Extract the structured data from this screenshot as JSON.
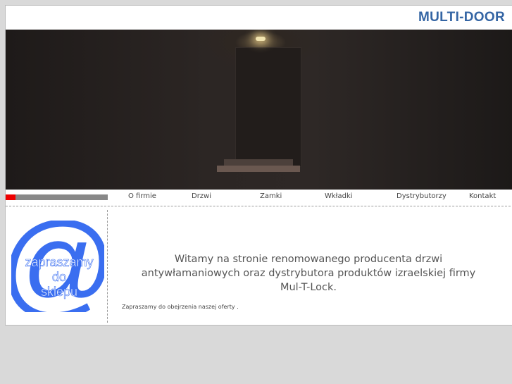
{
  "header": {
    "logo": "MULTI-DOOR"
  },
  "nav": {
    "items": [
      {
        "label": "O firmie"
      },
      {
        "label": "Drzwi"
      },
      {
        "label": "Zamki"
      },
      {
        "label": "Wkładki"
      },
      {
        "label": "Dystrybutorzy"
      },
      {
        "label": "Kontakt"
      }
    ]
  },
  "promo": {
    "line1": "zapraszamy",
    "line2": "do",
    "line3": "sklepu",
    "color": "#3a6ef0"
  },
  "main": {
    "welcome": "Witamy na stronie renomowanego producenta drzwi antywłamaniowych oraz dystrybutora produktów izraelskiej firmy Mul-T-Lock.",
    "offer": "Zapraszamy do obejrzenia naszej oferty ."
  }
}
